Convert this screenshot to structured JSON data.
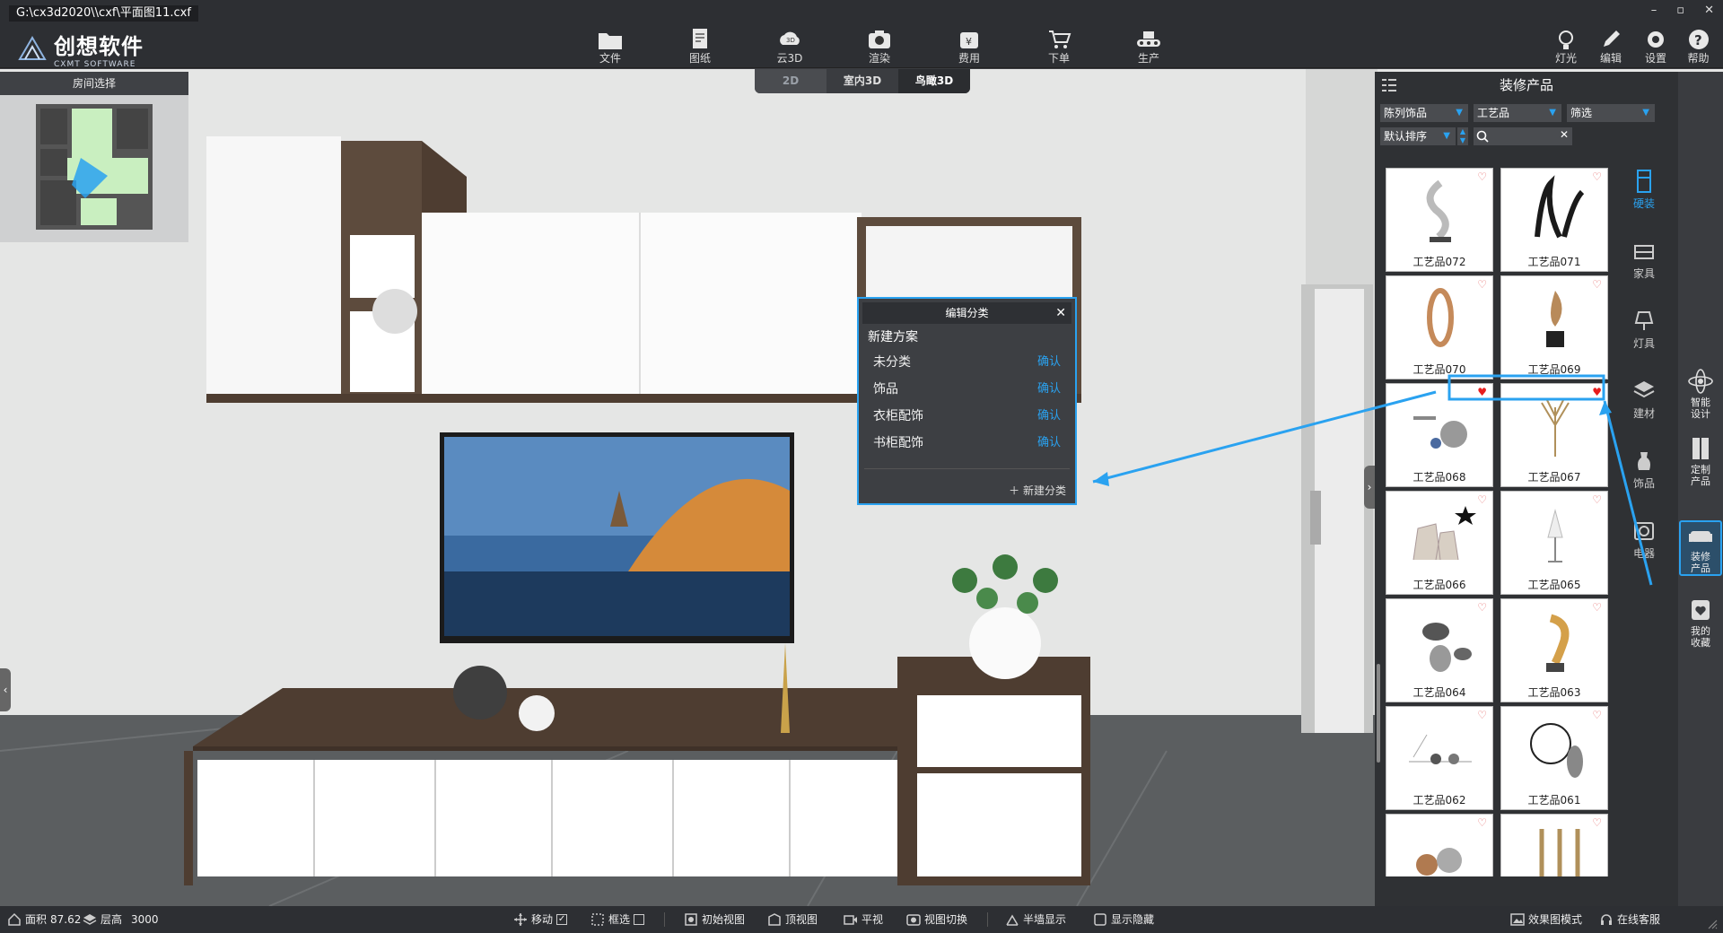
{
  "window": {
    "title": "G:\\cx3d2020\\\\cxf\\平面图11.cxf",
    "controls": [
      "–",
      "▫",
      "✕"
    ]
  },
  "logo": {
    "name_cn": "创想软件",
    "name_en": "CXMT SOFTWARE",
    "mark": "CXMT"
  },
  "toolbar": {
    "items": [
      {
        "label": "文件",
        "icon": "folder-icon"
      },
      {
        "label": "图纸",
        "icon": "drawing-icon"
      },
      {
        "label": "云3D",
        "icon": "cloud-3d-icon"
      },
      {
        "label": "渲染",
        "icon": "camera-icon"
      },
      {
        "label": "费用",
        "icon": "cost-icon"
      },
      {
        "label": "下单",
        "icon": "order-cart-icon"
      },
      {
        "label": "生产",
        "icon": "production-icon"
      }
    ],
    "right_items": [
      {
        "label": "灯光",
        "icon": "light-icon"
      },
      {
        "label": "编辑",
        "icon": "edit-icon"
      },
      {
        "label": "设置",
        "icon": "gear-icon"
      },
      {
        "label": "帮助",
        "icon": "help-icon"
      }
    ]
  },
  "view_tabs": {
    "items": [
      "2D",
      "室内3D",
      "鸟瞰3D"
    ],
    "active": "鸟瞰3D"
  },
  "room_panel": {
    "title": "房间选择"
  },
  "edit_dialog": {
    "title": "编辑分类",
    "new_plan": "新建方案",
    "rows": [
      {
        "label": "未分类",
        "action": "确认"
      },
      {
        "label": "饰品",
        "action": "确认"
      },
      {
        "label": "衣柜配饰",
        "action": "确认"
      },
      {
        "label": "书柜配饰",
        "action": "确认"
      }
    ],
    "footer": "新建分类"
  },
  "product_panel": {
    "title": "装修产品",
    "filters": {
      "category": "陈列饰品",
      "subcategory": "工艺品",
      "filter": "筛选",
      "sort": "默认排序",
      "search_value": ""
    },
    "products": [
      {
        "name": "工艺品072",
        "favorite": false
      },
      {
        "name": "工艺品071",
        "favorite": false
      },
      {
        "name": "工艺品070",
        "favorite": false
      },
      {
        "name": "工艺品069",
        "favorite": false
      },
      {
        "name": "工艺品068",
        "favorite": true
      },
      {
        "name": "工艺品067",
        "favorite": true
      },
      {
        "name": "工艺品066",
        "favorite": false
      },
      {
        "name": "工艺品065",
        "favorite": false
      },
      {
        "name": "工艺品064",
        "favorite": false
      },
      {
        "name": "工艺品063",
        "favorite": false
      },
      {
        "name": "工艺品062",
        "favorite": false
      },
      {
        "name": "工艺品061",
        "favorite": false
      },
      {
        "name": "",
        "favorite": false
      },
      {
        "name": "",
        "favorite": false
      }
    ],
    "categories": [
      {
        "label": "硬装",
        "active": true
      },
      {
        "label": "家具",
        "active": false
      },
      {
        "label": "灯具",
        "active": false
      },
      {
        "label": "建材",
        "active": false
      },
      {
        "label": "饰品",
        "active": false
      },
      {
        "label": "电器",
        "active": false
      }
    ]
  },
  "side_strip": [
    {
      "line1": "智能",
      "line2": "设计",
      "active": false
    },
    {
      "line1": "定制",
      "line2": "产品",
      "active": false
    },
    {
      "line1": "装修",
      "line2": "产品",
      "active": true
    },
    {
      "line1": "我的",
      "line2": "收藏",
      "active": false
    }
  ],
  "status": {
    "area_label": "面积",
    "area_value": "87.62",
    "height_label": "层高",
    "height_value": "3000",
    "move": "移动",
    "box_select": "框选",
    "initial_view": "初始视图",
    "top_view": "顶视图",
    "plan_view": "平视",
    "switch_view": "视图切换",
    "half_wall": "半墙显示",
    "show_hide": "显示隐藏",
    "render_mode": "效果图模式",
    "support": "在线客服"
  },
  "colors": {
    "accent": "#2aa2f0",
    "panel": "#2f3134",
    "toolbar": "#2d2f33",
    "favorite": "#e81d1d"
  }
}
